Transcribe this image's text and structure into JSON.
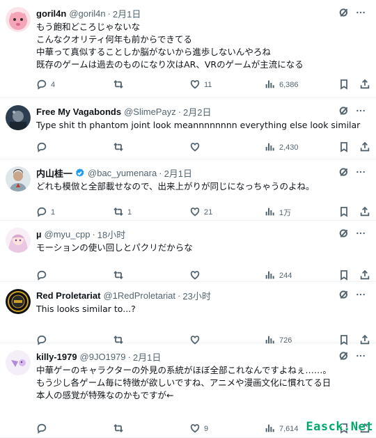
{
  "tweets": [
    {
      "name": "goril4n",
      "handle": "@goril4n",
      "sep": "·",
      "time": "2月1日",
      "verified": false,
      "avatar_color": "#f4a6b8",
      "lines": [
        "もう飽和どころじゃないな",
        "こんなクオリティ何年も前からできてる",
        "中華って真似することしか脳がないから進歩しないんやろね",
        "既存のゲームは過去のものになり次はAR、VRのゲームが主流になる"
      ],
      "replies": "4",
      "retweets": "",
      "likes": "11",
      "views": "6,386"
    },
    {
      "name": "Free My Vagabonds",
      "handle": "@SlimePayz",
      "sep": "·",
      "time": "2月2日",
      "verified": false,
      "avatar_color": "#2c3e50",
      "lines": [
        "Type shit th phantom joint look meannnnnnnn everything else  look similar"
      ],
      "replies": "",
      "retweets": "",
      "likes": "",
      "views": "2,430"
    },
    {
      "name": "内山桂一",
      "handle": "@bac_yumenara",
      "sep": "·",
      "time": "2月1日",
      "verified": true,
      "avatar_color": "#c9a58a",
      "lines": [
        "どれも模倣と全部載せなので、出来上がりが同じになっちゃうのよね。"
      ],
      "replies": "1",
      "retweets": "1",
      "likes": "21",
      "views": "1万"
    },
    {
      "name": "µ",
      "handle": "@myu_cpp",
      "sep": "·",
      "time": "18小时",
      "verified": false,
      "avatar_color": "#e9c7e2",
      "lines": [
        "モーションの使い回しとパクリだからな"
      ],
      "replies": "",
      "retweets": "",
      "likes": "",
      "views": "244"
    },
    {
      "name": "Red Proletariat",
      "handle": "@1RedProletariat",
      "sep": "·",
      "time": "23小时",
      "verified": false,
      "avatar_color": "#111111",
      "lines": [
        "This looks similar to...?"
      ],
      "replies": "",
      "retweets": "",
      "likes": "",
      "views": "726"
    },
    {
      "name": "killy-1979",
      "handle": "@9JO1979",
      "sep": "·",
      "time": "2月1日",
      "verified": false,
      "avatar_color": "#f3eef8",
      "lines": [
        "中華ゲーのキャラクターの外見の系統がほぼ全部これなんですよねぇ……。",
        "もう少し各ゲーム毎に特徴が欲しいですね、アニメや漫画文化に慣れてる日",
        "本人の感覚が特殊なのかもですが←"
      ],
      "replies": "",
      "retweets": "",
      "likes": "9",
      "views": "7,614"
    }
  ],
  "watermark": "Easck.Net",
  "colors": {
    "text": "#0f1419",
    "muted": "#536471",
    "verified": "#1d9bf0",
    "divider": "#eff3f4"
  },
  "icons": [
    "grok-icon",
    "more-icon",
    "reply-icon",
    "retweet-icon",
    "like-icon",
    "views-icon",
    "bookmark-icon",
    "share-icon",
    "verified-badge-icon"
  ]
}
